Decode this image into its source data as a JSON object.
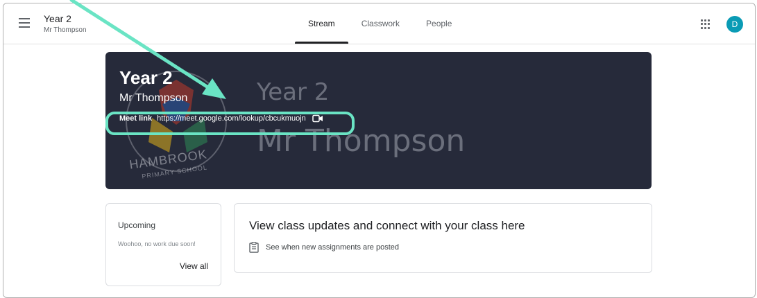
{
  "header": {
    "class_name": "Year 2",
    "teacher": "Mr Thompson",
    "tabs": [
      {
        "label": "Stream",
        "active": true
      },
      {
        "label": "Classwork",
        "active": false
      },
      {
        "label": "People",
        "active": false
      }
    ],
    "avatar_initial": "D",
    "icons": [
      "menu-icon",
      "apps-grid-icon"
    ]
  },
  "banner": {
    "title": "Year 2",
    "teacher": "Mr Thompson",
    "meet_label": "Meet link",
    "meet_url": "https://meet.google.com/lookup/cbcukmuojn",
    "bg_title": "Year 2",
    "bg_teacher": "Mr Thompson",
    "crest_main": "HAMBROOK",
    "crest_sub": "PRIMARY SCHOOL",
    "background_color": "#262a3a"
  },
  "upcoming": {
    "title": "Upcoming",
    "message": "Woohoo, no work due soon!",
    "link": "View all"
  },
  "stream": {
    "title": "View class updates and connect with your class here",
    "item": "See when new assignments are posted"
  },
  "colors": {
    "highlight": "#6ae4c4",
    "avatar": "#0a9bb5"
  }
}
